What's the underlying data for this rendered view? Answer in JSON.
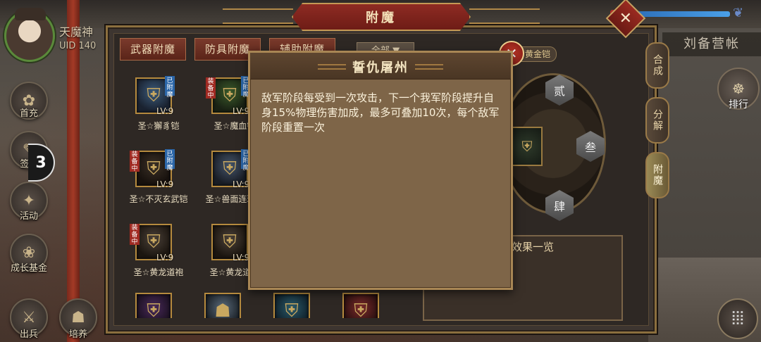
{
  "player": {
    "name": "天魔神",
    "uid": "UID  140"
  },
  "side_menu": [
    {
      "label": "首充",
      "icon": "gift-icon"
    },
    {
      "label": "签",
      "icon": "sign-icon"
    },
    {
      "label": "活动",
      "icon": "activity-icon"
    },
    {
      "label": "成长基金",
      "icon": "fund-icon"
    },
    {
      "label": "出兵",
      "icon": "army-icon"
    },
    {
      "label": "培养",
      "icon": "train-icon"
    }
  ],
  "float_ball": "3",
  "camp_title": "刘备营帐",
  "rank_label": "排行",
  "panel": {
    "title": "附魔",
    "close": "✕"
  },
  "tabs": [
    "武器附魔",
    "防具附魔",
    "辅助附魔"
  ],
  "filter": "全部",
  "items": [
    {
      "name": "圣☆獬豸铠",
      "lv": "LV:9",
      "enchanted": "已附魔",
      "equipped": ""
    },
    {
      "name": "圣☆魔血铠",
      "lv": "LV:9",
      "enchanted": "已附魔",
      "equipped": "装备中"
    },
    {
      "name": "圣☆不灭玄武铠",
      "lv": "LV:9",
      "enchanted": "已附魔",
      "equipped": "装备中"
    },
    {
      "name": "圣☆兽面连环铠",
      "lv": "LV:9",
      "enchanted": "已附魔",
      "equipped": ""
    },
    {
      "name": "圣☆黄龙道袍",
      "lv": "LV:9",
      "enchanted": "",
      "equipped": "装备中"
    },
    {
      "name": "圣☆黄龙道袍",
      "lv": "LV:9",
      "enchanted": "",
      "equipped": ""
    }
  ],
  "gold_tag": "黄金铠",
  "hex_buttons": [
    "贰",
    "叁",
    "肆"
  ],
  "vertical_tabs": [
    "合成",
    "分解",
    "附魔"
  ],
  "effects_title": "效果一览",
  "popup": {
    "title": "誓仇屠州",
    "description": "敌军阶段每受到一次攻击，下一个我军阶段提升自身15%物理伤害加成，最多可叠加10次，每个敌军阶段重置一次"
  }
}
